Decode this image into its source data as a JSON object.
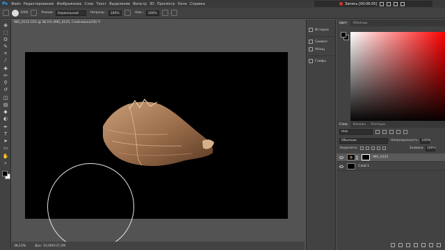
{
  "menubar": {
    "logo": "Ps",
    "items": [
      "Файл",
      "Редактирование",
      "Изображение",
      "Слои",
      "Текст",
      "Выделение",
      "Фильтр",
      "3D",
      "Просмотр",
      "Окно",
      "Справка"
    ],
    "recording": "Запись [00:06:05]"
  },
  "options": {
    "brush_size": "1000",
    "mode_label": "Режим:",
    "mode_value": "Нормальный",
    "opacity_label": "Непрозр.:",
    "opacity_value": "100%",
    "flow_label": "Наж.:",
    "flow_value": "100%"
  },
  "document": {
    "tab_title": "IMG_0112.CR2 @ 38,1% (IMG_0125, Слой-маска/16) *",
    "zoom": "38,13%",
    "doc_info": "Док: 33,0M/137,2M"
  },
  "tools": [
    "move-tool",
    "marquee-tool",
    "lasso-tool",
    "quick-select-tool",
    "crop-tool",
    "eyedropper-tool",
    "healing-tool",
    "brush-tool",
    "stamp-tool",
    "history-brush-tool",
    "eraser-tool",
    "gradient-tool",
    "blur-tool",
    "dodge-tool",
    "pen-tool",
    "type-tool",
    "path-select-tool",
    "shape-tool",
    "hand-tool",
    "zoom-tool"
  ],
  "tool_glyphs": [
    "✥",
    "⬚",
    "ʘ",
    "✎",
    "⌗",
    "⁄",
    "✚",
    "✏",
    "⚲",
    "↺",
    "◫",
    "▤",
    "◆",
    "◐",
    "✒",
    "T",
    "➤",
    "▭",
    "✋",
    "⌕"
  ],
  "panelstrip": {
    "history": "История",
    "brushes": "Символ",
    "paragraph": "Абзац",
    "glyphs": "Глифы"
  },
  "color_panel": {
    "tabs": [
      "Цвет",
      "Образцы"
    ],
    "foreground": "#000000",
    "background": "#111111"
  },
  "layers_panel": {
    "tabs": [
      "Слои",
      "Каналы",
      "Контуры"
    ],
    "filter_label": "Вид",
    "blend_mode": "Обычные",
    "opacity_label": "Непрозрачность:",
    "opacity_value": "100%",
    "lock_label": "Закрепить:",
    "fill_label": "Заливка:",
    "fill_value": "100%",
    "layers": [
      {
        "name": "IMG_0125",
        "selected": true
      },
      {
        "name": "Слой 1",
        "selected": false
      }
    ]
  }
}
